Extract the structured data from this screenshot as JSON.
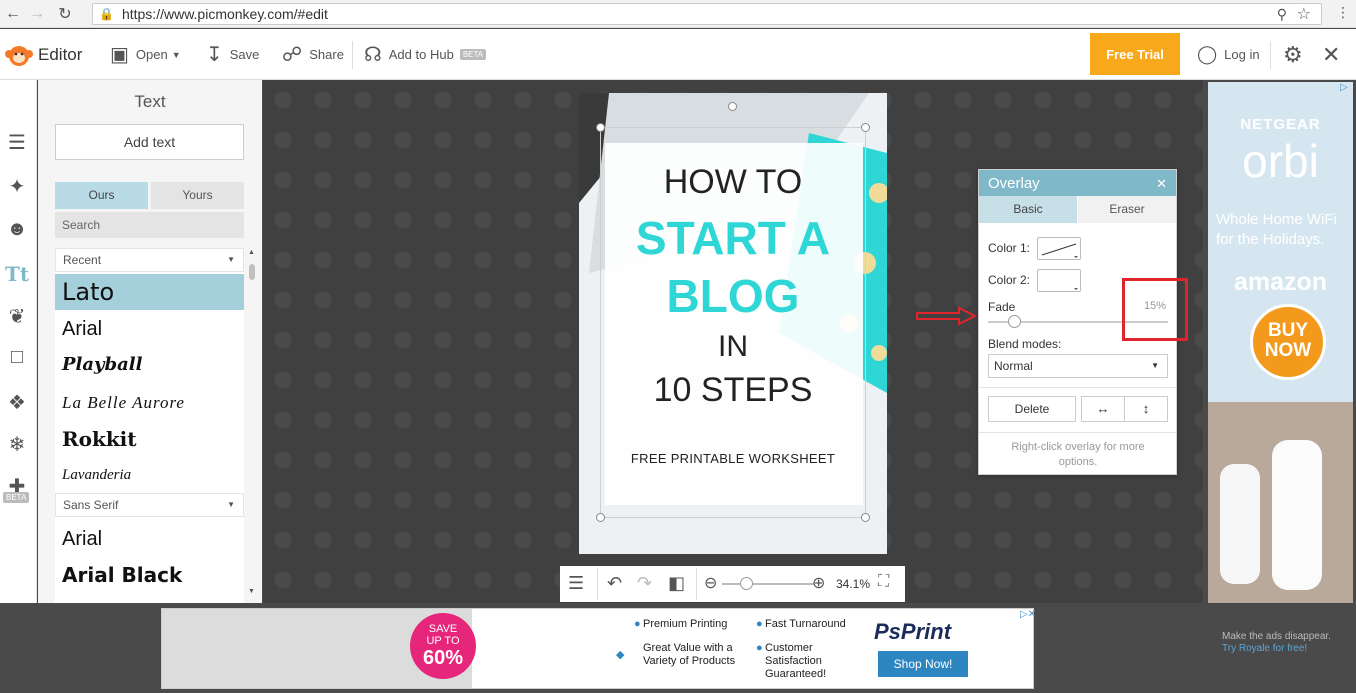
{
  "browser": {
    "url": "https://www.picmonkey.com/#edit"
  },
  "toolbar": {
    "app_name": "Editor",
    "open_label": "Open",
    "save_label": "Save",
    "share_label": "Share",
    "hub_label": "Add to Hub",
    "beta_label": "BETA",
    "free_trial_label": "Free Trial",
    "login_label": "Log in"
  },
  "rail": {
    "beta_label": "BETA"
  },
  "text_panel": {
    "title": "Text",
    "add_text_label": "Add text",
    "tabs": [
      "Ours",
      "Yours"
    ],
    "search_placeholder": "Search",
    "categories": [
      "Recent",
      "Sans Serif"
    ],
    "recent_fonts": [
      "Lato",
      "Arial",
      "Playball",
      "La Belle Aurore",
      "Rokkit",
      "Lavanderia"
    ],
    "sans_fonts": [
      "Arial",
      "Arial Black"
    ]
  },
  "poster": {
    "line1": "HOW TO",
    "line2": "START A",
    "line3": "BLOG",
    "line4": "IN",
    "line5": "10 STEPS",
    "footer": "FREE PRINTABLE WORKSHEET"
  },
  "zoom": {
    "level": "34.1%",
    "fraction": 0.27
  },
  "overlay": {
    "title": "Overlay",
    "tabs": [
      "Basic",
      "Eraser"
    ],
    "color1_label": "Color 1:",
    "color2_label": "Color 2:",
    "fade_label": "Fade",
    "fade_value": "15%",
    "fade_fraction": 0.15,
    "blend_label": "Blend modes:",
    "blend_value": "Normal",
    "delete_label": "Delete",
    "hint": "Right-click overlay for more options."
  },
  "right_ad": {
    "brand": "NETGEAR",
    "product": "orbi",
    "tagline": "Whole Home WiFi for the Holidays.",
    "store": "amazon",
    "cta": "BUY NOW"
  },
  "bottom_ad": {
    "save_badge": [
      "SAVE",
      "UP TO",
      "60%"
    ],
    "features": [
      "Premium Printing",
      "Fast Turnaround",
      "Great Value with a Variety of Products",
      "Customer Satisfaction Guaranteed!"
    ],
    "brand": "PsPrint",
    "cta": "Shop Now!"
  },
  "ads_note": {
    "line1": "Make the ads disappear.",
    "link": "Try Royale for free!"
  },
  "colors": {
    "accent_teal": "#2ed6d6",
    "overlay_header": "#7fb8c9",
    "free_trial": "#f7a81b",
    "highlight_red": "#e0242b",
    "selected_font": "#a5cfdb"
  }
}
